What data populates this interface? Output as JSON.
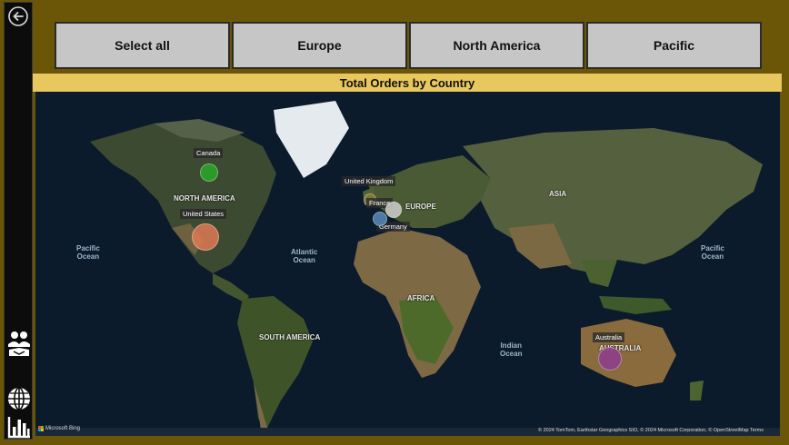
{
  "sidebar": {
    "back_icon": "back-arrow-icon",
    "icons": [
      "customers-icon",
      "globe-icon",
      "bar-chart-icon"
    ]
  },
  "filters": {
    "buttons": [
      "Select all",
      "Europe",
      "North America",
      "Pacific"
    ]
  },
  "map": {
    "title": "Total Orders by Country",
    "regions": [
      "NORTH AMERICA",
      "EUROPE",
      "ASIA",
      "AFRICA",
      "SOUTH AMERICA",
      "AUSTRALIA"
    ],
    "oceans": [
      "Pacific\nOcean",
      "Atlantic\nOcean",
      "Indian\nOcean",
      "Pacific\nOcean"
    ],
    "countries": [
      {
        "name": "Canada",
        "color": "#2aa82a"
      },
      {
        "name": "United States",
        "color": "#e07a53"
      },
      {
        "name": "United Kingdom",
        "color": "#8a7a3a"
      },
      {
        "name": "France",
        "color": "#cfcfcf"
      },
      {
        "name": "Germany",
        "color": "#5a8ab8"
      },
      {
        "name": "Australia",
        "color": "#8e3d8e"
      }
    ],
    "attribution": "© 2024 TomTom, Earthstar Geographics SIO, © 2024 Microsoft Corporation, © OpenStreetMap  Terms",
    "bing": "Microsoft Bing"
  }
}
